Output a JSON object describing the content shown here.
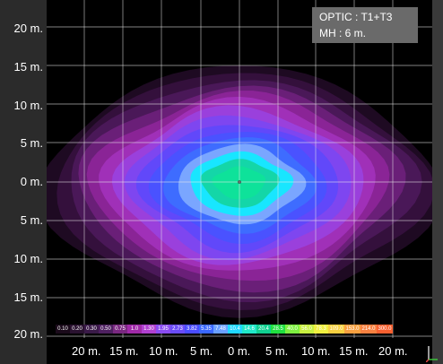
{
  "info": {
    "optic": "OPTIC : T1+T3",
    "mh": "MH : 6 m."
  },
  "y_labels": [
    "20 m.",
    "15 m.",
    "10 m.",
    "5 m.",
    "0 m.",
    "5 m.",
    "10 m.",
    "15 m.",
    "20 m."
  ],
  "x_labels": [
    "20 m.",
    "15 m.",
    "10 m.",
    "5 m.",
    "0 m.",
    "5 m.",
    "10 m.",
    "15 m.",
    "20 m."
  ],
  "legend": [
    {
      "label": "0.10",
      "color": "#1a0a1a"
    },
    {
      "label": "0.20",
      "color": "#2a1230"
    },
    {
      "label": "0.30",
      "color": "#3a1a48"
    },
    {
      "label": "0.50",
      "color": "#4e2060"
    },
    {
      "label": "0.75",
      "color": "#7a2880"
    },
    {
      "label": "1.0",
      "color": "#a02aa8"
    },
    {
      "label": "1.30",
      "color": "#b040d0"
    },
    {
      "label": "1.95",
      "color": "#8a4cf0"
    },
    {
      "label": "2.73",
      "color": "#6a4cf8"
    },
    {
      "label": "3.82",
      "color": "#4a4cff"
    },
    {
      "label": "5.35",
      "color": "#3a68ff"
    },
    {
      "label": "7.48",
      "color": "#6aa0ff"
    },
    {
      "label": "10.4",
      "color": "#20d8ff"
    },
    {
      "label": "14.6",
      "color": "#20e8c8"
    },
    {
      "label": "20.4",
      "color": "#10d090"
    },
    {
      "label": "28.5",
      "color": "#20e040"
    },
    {
      "label": "40.0",
      "color": "#7ef040"
    },
    {
      "label": "56.0",
      "color": "#c8f040"
    },
    {
      "label": "78.3",
      "color": "#f0f040"
    },
    {
      "label": "109.0",
      "color": "#f8d040"
    },
    {
      "label": "153.0",
      "color": "#f8a040"
    },
    {
      "label": "214.0",
      "color": "#f88040"
    },
    {
      "label": "300.0",
      "color": "#f86030"
    }
  ],
  "contour_colors": [
    "#1e0a22",
    "#34103c",
    "#4a1858",
    "#6a1f78",
    "#8a2496",
    "#a030b8",
    "#9a40dc",
    "#7e46f0",
    "#6148fa",
    "#4a52ff",
    "#3e6cff",
    "#7aa6ff",
    "#18e6ff",
    "#14d6a8",
    "#0ee29a"
  ]
}
